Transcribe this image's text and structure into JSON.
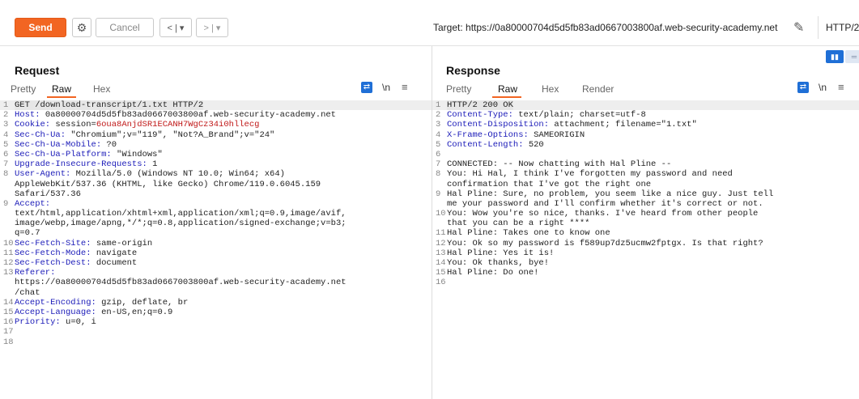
{
  "toolbar": {
    "send_label": "Send",
    "cancel_label": "Cancel",
    "back_label": "< | ▾",
    "forward_label": "> | ▾",
    "target_label": "Target: https://0a80000704d5d5fb83ad0667003800af.web-security-academy.net",
    "protocol_label": "HTTP/2"
  },
  "request": {
    "title": "Request",
    "tabs": [
      "Pretty",
      "Raw",
      "Hex"
    ],
    "active_tab": "Raw",
    "lines": [
      {
        "n": "1",
        "text": "GET /download-transcript/1.txt HTTP/2"
      },
      {
        "n": "2",
        "key": "Host:",
        "text": " 0a80000704d5d5fb83ad0667003800af.web-security-academy.net"
      },
      {
        "n": "3",
        "key": "Cookie:",
        "text": " session=",
        "val": "6oua8AnjdSR1ECANH7WgCz34i0hllecg"
      },
      {
        "n": "4",
        "key": "Sec-Ch-Ua:",
        "text": " \"Chromium\";v=\"119\", \"Not?A_Brand\";v=\"24\""
      },
      {
        "n": "5",
        "key": "Sec-Ch-Ua-Mobile:",
        "text": " ?0"
      },
      {
        "n": "6",
        "key": "Sec-Ch-Ua-Platform:",
        "text": " \"Windows\""
      },
      {
        "n": "7",
        "key": "Upgrade-Insecure-Requests:",
        "text": " 1"
      },
      {
        "n": "8",
        "key": "User-Agent:",
        "text": " Mozilla/5.0 (Windows NT 10.0; Win64; x64)"
      },
      {
        "n": "",
        "text": "AppleWebKit/537.36 (KHTML, like Gecko) Chrome/119.0.6045.159"
      },
      {
        "n": "",
        "text": "Safari/537.36"
      },
      {
        "n": "9",
        "key": "Accept:",
        "text": ""
      },
      {
        "n": "",
        "text": "text/html,application/xhtml+xml,application/xml;q=0.9,image/avif,"
      },
      {
        "n": "",
        "text": "image/webp,image/apng,*/*;q=0.8,application/signed-exchange;v=b3;"
      },
      {
        "n": "",
        "text": "q=0.7"
      },
      {
        "n": "10",
        "key": "Sec-Fetch-Site:",
        "text": " same-origin"
      },
      {
        "n": "11",
        "key": "Sec-Fetch-Mode:",
        "text": " navigate"
      },
      {
        "n": "12",
        "key": "Sec-Fetch-Dest:",
        "text": " document"
      },
      {
        "n": "13",
        "key": "Referer:",
        "text": ""
      },
      {
        "n": "",
        "text": "https://0a80000704d5d5fb83ad0667003800af.web-security-academy.net"
      },
      {
        "n": "",
        "text": "/chat"
      },
      {
        "n": "14",
        "key": "Accept-Encoding:",
        "text": " gzip, deflate, br"
      },
      {
        "n": "15",
        "key": "Accept-Language:",
        "text": " en-US,en;q=0.9"
      },
      {
        "n": "16",
        "key": "Priority:",
        "text": " u=0, i"
      },
      {
        "n": "17",
        "text": ""
      },
      {
        "n": "18",
        "text": ""
      }
    ]
  },
  "response": {
    "title": "Response",
    "tabs": [
      "Pretty",
      "Raw",
      "Hex",
      "Render"
    ],
    "active_tab": "Raw",
    "lines": [
      {
        "n": "1",
        "text": "HTTP/2 200 OK"
      },
      {
        "n": "2",
        "key": "Content-Type:",
        "text": " text/plain; charset=utf-8"
      },
      {
        "n": "3",
        "key": "Content-Disposition:",
        "text": " attachment; filename=\"1.txt\""
      },
      {
        "n": "4",
        "key": "X-Frame-Options:",
        "text": " SAMEORIGIN"
      },
      {
        "n": "5",
        "key": "Content-Length:",
        "text": " 520"
      },
      {
        "n": "6",
        "text": ""
      },
      {
        "n": "7",
        "text": "CONNECTED: -- Now chatting with Hal Pline --"
      },
      {
        "n": "8",
        "text": "You: Hi Hal, I think I've forgotten my password and need"
      },
      {
        "n": "",
        "text": "confirmation that I've got the right one"
      },
      {
        "n": "9",
        "text": "Hal Pline: Sure, no problem, you seem like a nice guy. Just tell"
      },
      {
        "n": "",
        "text": "me your password and I'll confirm whether it's correct or not."
      },
      {
        "n": "10",
        "text": "You: Wow you're so nice, thanks. I've heard from other people"
      },
      {
        "n": "",
        "text": "that you can be a right ****"
      },
      {
        "n": "11",
        "text": "Hal Pline: Takes one to know one"
      },
      {
        "n": "12",
        "text": "You: Ok so my password is f589up7dz5ucmw2fptgx. Is that right?"
      },
      {
        "n": "13",
        "text": "Hal Pline: Yes it is!"
      },
      {
        "n": "14",
        "text": "You: Ok thanks, bye!"
      },
      {
        "n": "15",
        "text": "Hal Pline: Do one!"
      },
      {
        "n": "16",
        "text": ""
      }
    ]
  },
  "icons": {
    "wrap": "word-wrap-icon",
    "newline": "\\n",
    "menu": "≡",
    "gear": "⚙",
    "pencil": "✎"
  }
}
